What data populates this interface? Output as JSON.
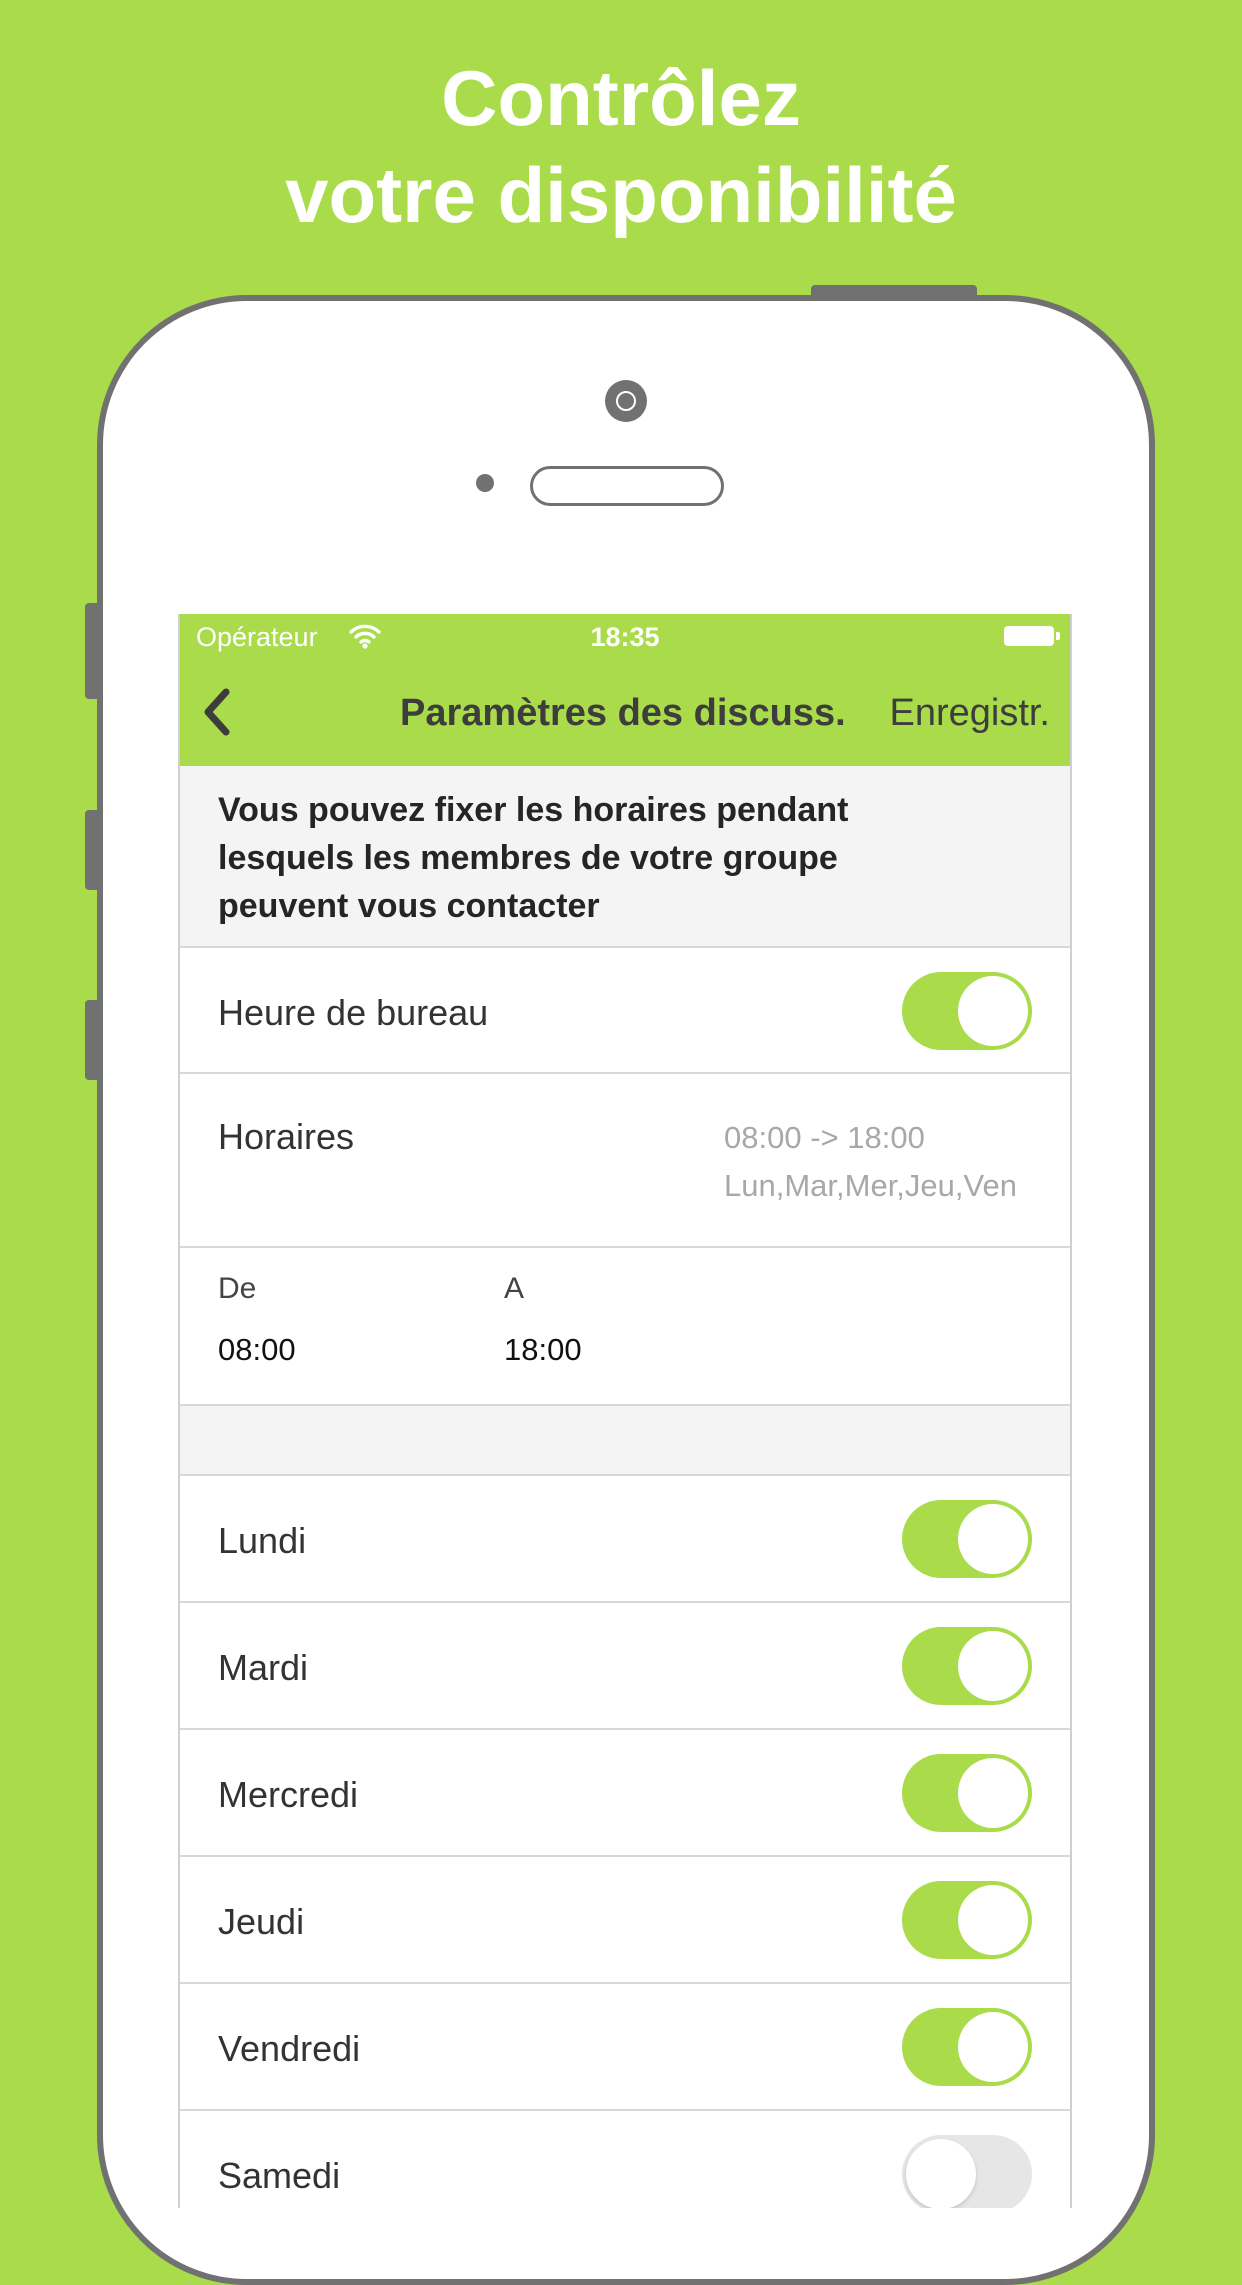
{
  "headline": {
    "line1": "Contrôlez",
    "line2": "votre disponibilité"
  },
  "status_bar": {
    "carrier": "Opérateur",
    "time": "18:35"
  },
  "nav": {
    "title": "Paramètres des discuss.",
    "save_label": "Enregistr."
  },
  "intro": "Vous pouvez fixer les horaires pendant lesquels les membres de votre groupe peuvent vous contacter",
  "office_hours": {
    "label": "Heure de bureau",
    "enabled": true
  },
  "schedule": {
    "label": "Horaires",
    "hours": "08:00 -> 18:00",
    "days": "Lun,Mar,Mer,Jeu,Ven"
  },
  "range": {
    "from_label": "De",
    "from_value": "08:00",
    "to_label": "A",
    "to_value": "18:00"
  },
  "days": [
    {
      "label": "Lundi",
      "enabled": true
    },
    {
      "label": "Mardi",
      "enabled": true
    },
    {
      "label": "Mercredi",
      "enabled": true
    },
    {
      "label": "Jeudi",
      "enabled": true
    },
    {
      "label": "Vendredi",
      "enabled": true
    },
    {
      "label": "Samedi",
      "enabled": false
    }
  ],
  "colors": {
    "accent": "#a9db4a",
    "frame": "#717171"
  },
  "icons": {
    "back": "chevron-left-icon",
    "wifi": "wifi-icon",
    "battery": "battery-icon"
  }
}
